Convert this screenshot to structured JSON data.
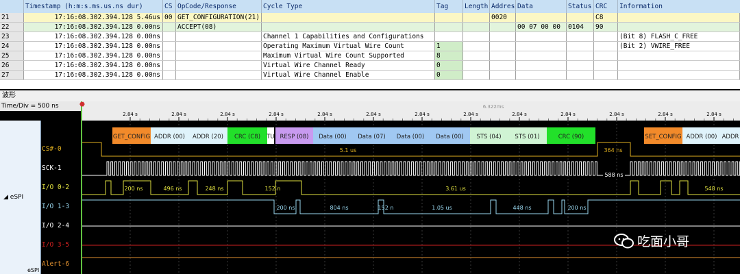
{
  "table": {
    "headers": [
      "Timestamp (h:m:s.ms.us.ns dur)",
      "CS",
      "OpCode/Response",
      "Cycle Type",
      "Tag",
      "Length",
      "Addres",
      "Data",
      "Status",
      "CRC",
      "Information"
    ],
    "rows": [
      {
        "num": "21",
        "ts": "17:16:08.302.394.128 5.46us",
        "cs": "00",
        "op": "GET_CONFIGURATION(21)",
        "cycle": "",
        "tag": "",
        "len": "",
        "addr": "0020",
        "data": "",
        "status": "",
        "crc": "C8",
        "info": ""
      },
      {
        "num": "22",
        "ts": "17:16:08.302.394.128 0.00ns",
        "cs": "",
        "op": "ACCEPT(08)",
        "cycle": "",
        "tag": "",
        "len": "",
        "addr": "",
        "data": "00 07 00 00",
        "status": "0104",
        "crc": "90",
        "info": ""
      },
      {
        "num": "23",
        "ts": "17:16:08.302.394.128 0.00ns",
        "cs": "",
        "op": "",
        "cycle": "Channel 1 Capabilities and Configurations",
        "tag": "",
        "len": "",
        "addr": "",
        "data": "",
        "status": "",
        "crc": "",
        "info": "(Bit 8) FLASH_C_FREE"
      },
      {
        "num": "24",
        "ts": "17:16:08.302.394.128 0.00ns",
        "cs": "",
        "op": "",
        "cycle": "Operating Maximum Virtual Wire Count",
        "tag": "1",
        "len": "",
        "addr": "",
        "data": "",
        "status": "",
        "crc": "",
        "info": "(Bit 2) VWIRE_FREE"
      },
      {
        "num": "25",
        "ts": "17:16:08.302.394.128 0.00ns",
        "cs": "",
        "op": "",
        "cycle": "Maximum Virtual Wire Count Supported",
        "tag": "8",
        "len": "",
        "addr": "",
        "data": "",
        "status": "",
        "crc": "",
        "info": ""
      },
      {
        "num": "26",
        "ts": "17:16:08.302.394.128 0.00ns",
        "cs": "",
        "op": "",
        "cycle": "Virtual Wire Channel Ready",
        "tag": "0",
        "len": "",
        "addr": "",
        "data": "",
        "status": "",
        "crc": "",
        "info": ""
      },
      {
        "num": "27",
        "ts": "17:16:08.302.394.128 0.00ns",
        "cs": "",
        "op": "",
        "cycle": "Virtual Wire Channel Enable",
        "tag": "0",
        "len": "",
        "addr": "",
        "data": "",
        "status": "",
        "crc": "",
        "info": ""
      }
    ]
  },
  "waveform": {
    "title": "波形",
    "time_div": "Time/Div = 500 ns",
    "cursor_label": "6.322ms",
    "tick_labels": [
      "2.84 s",
      "2.84 s",
      "2.84 s",
      "2.84 s",
      "2.84 s",
      "2.84 s",
      "2.84 s",
      "2.84 s",
      "2.84 s",
      "2.84 s",
      "2.84 s",
      "2.84 s",
      "2.84 s",
      "2.84 s"
    ],
    "group_label": "eSPI",
    "group_label_bottom": "eSPI",
    "signals": [
      {
        "name": "CS#-0",
        "color": "#e0b020"
      },
      {
        "name": "SCK-1",
        "color": "#ffffff"
      },
      {
        "name": "I/O 0-2",
        "color": "#e0e040"
      },
      {
        "name": "I/O 1-3",
        "color": "#9ad8f0"
      },
      {
        "name": "I/O 2-4",
        "color": "#ffffff"
      },
      {
        "name": "I/O 3-5",
        "color": "#d02020"
      },
      {
        "name": "Alert-6",
        "color": "#e09030"
      }
    ],
    "packets": [
      {
        "label": "GET_CONFIG",
        "color": "#f28a2a"
      },
      {
        "label": "ADDR (00)",
        "color": "#dff3fb"
      },
      {
        "label": "ADDR (20)",
        "color": "#dff3fb"
      },
      {
        "label": "CRC (C8)",
        "color": "#22e02a"
      },
      {
        "label": "TU",
        "color": "#ffffff"
      },
      {
        "label": "RESP (08)",
        "color": "#c89af0"
      },
      {
        "label": "Data (00)",
        "color": "#a0c8f2"
      },
      {
        "label": "Data (07)",
        "color": "#a0c8f2"
      },
      {
        "label": "Data (00)",
        "color": "#a0c8f2"
      },
      {
        "label": "Data (00)",
        "color": "#a0c8f2"
      },
      {
        "label": "STS (04)",
        "color": "#d0f4d4"
      },
      {
        "label": "STS (01)",
        "color": "#d0f4d4"
      },
      {
        "label": "CRC (90)",
        "color": "#22e02a"
      },
      {
        "label": "SET_CONFIG",
        "color": "#f28a2a"
      },
      {
        "label": "ADDR (00)",
        "color": "#dff3fb"
      },
      {
        "label": "ADDR",
        "color": "#dff3fb"
      }
    ],
    "measurements": {
      "cs_low": "5.1 us",
      "cs_high": "364 ns",
      "sck_period": "588 ns",
      "io0": [
        "200 ns",
        "496 ns",
        "248 ns",
        "152 n",
        "3.61 us",
        "548 ns"
      ],
      "io1": [
        "200 ns",
        "804 ns",
        "152 n",
        "1.05 us",
        "448 ns",
        "200 ns"
      ]
    },
    "watermark": "吃面小哥"
  }
}
